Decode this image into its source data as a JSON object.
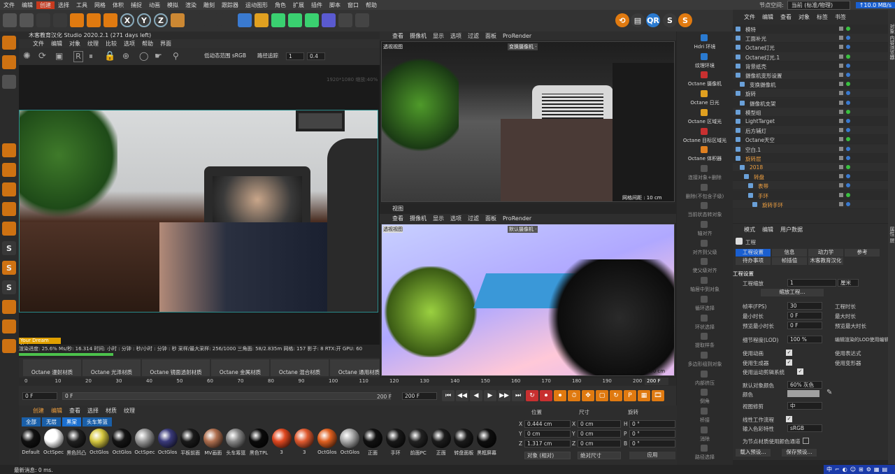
{
  "menubar": {
    "items": [
      "文件",
      "编辑",
      "创建",
      "选择",
      "工具",
      "网格",
      "体积",
      "捕捉",
      "动画",
      "模拟",
      "渲染",
      "雕刻",
      "跟踪器",
      "运动图形",
      "角色",
      "扩展",
      "插件",
      "脚本",
      "窗口",
      "帮助"
    ],
    "layout_label": "节点空间:",
    "layout_value": "当前 (标准/物理)",
    "net_speed": "↑10.0 MB/s"
  },
  "toolbar": {
    "icons": [
      "undo-icon",
      "redo-icon",
      "select-icon",
      "move-icon",
      "scale-icon",
      "rotate-icon",
      "recent-icon",
      "x-axis-icon",
      "y-axis-icon",
      "z-axis-icon",
      "coord-icon",
      "render-view-icon",
      "render-icon",
      "render-settings-icon",
      "cube-icon",
      "pen-icon",
      "subdiv-icon",
      "extrude-icon",
      "array-icon",
      "deformer-icon",
      "camera-icon",
      "light-icon"
    ],
    "xyz": [
      "X",
      "Y",
      "Z"
    ]
  },
  "left_tools": {
    "icons": [
      "model-mode-icon",
      "texture-mode-icon",
      "workplane-icon",
      "point-icon",
      "edge-icon",
      "polygon-icon",
      "uv-icon",
      "snap-icon",
      "s1-icon",
      "s2-icon",
      "s3-icon",
      "magnet-icon",
      "grid-icon",
      "paint-icon"
    ]
  },
  "preview": {
    "title": "木客教育汉化 Studio 2020.2.1 (271 days left)",
    "menu": [
      "文件",
      "编辑",
      "对象",
      "纹理",
      "比较",
      "选项",
      "帮助",
      "界面"
    ],
    "tonemap_label": "低动态范围 sRGB",
    "track": "路径追踪",
    "spin1": "1",
    "spin2": "0.4",
    "res_text": "1920*1080 缩放:40%",
    "caption": "Your Dream Noise",
    "status": "渲染进度: 25.6%  Ms/秒: 16.314  时间: 小时 : 分钟 : 秒/小时 : 分钟 : 秒  采样/最大采样: 256/1000  三角面: 58/2.835m  网格: 157  影子: 8  RTX:开  GPU:  60"
  },
  "octane_mat_tabs": [
    "Octane 漫射材质",
    "Octane 光泽材质",
    "Octane 镜面透射材质",
    "Octane 金属材质",
    "Octane 混合材质",
    "Octane 通用材质"
  ],
  "viewport_top": {
    "menu": [
      "查看",
      "摄像机",
      "显示",
      "选项",
      "过滤",
      "面板",
      "ProRender"
    ],
    "label": "透视视图",
    "cam": "变换摄像机 ·",
    "grid": "网格间距 : 10 cm"
  },
  "viewport_bottom": {
    "title": "视图",
    "menu": [
      "查看",
      "摄像机",
      "显示",
      "选项",
      "过滤",
      "面板",
      "ProRender"
    ],
    "label": "透视视图",
    "cam": "默认摄像机 ·",
    "grid": "网格间距 : 100 cm"
  },
  "octane_cmds": [
    "Hdri 环境",
    "纹理环境",
    "Octane 摄像机",
    "Octane 日光",
    "Octane 区域光",
    "Octane 目标区域光",
    "Octane 体积器",
    "连接对象+删除",
    "删除(不包含子级)",
    "当前状态转对象",
    "轴对齐",
    "对齐到父级",
    "使父级对齐",
    "轴居中到对象",
    "循环选择",
    "环状选择",
    "提取样条",
    "多边形组到对象",
    "内部挤压",
    "倒角",
    "桥接",
    "消除",
    "路径选择"
  ],
  "objects": {
    "header": [
      "文件",
      "编辑",
      "查看",
      "对象",
      "标签",
      "书签"
    ],
    "rows": [
      {
        "name": "模特",
        "indent": 0,
        "color": "#d0d0d0"
      },
      {
        "name": "工面补光",
        "indent": 0,
        "color": "#d0d0d0"
      },
      {
        "name": "Octane灯光",
        "indent": 0,
        "color": "#d0d0d0"
      },
      {
        "name": "Octane灯光.1",
        "indent": 0,
        "color": "#d0d0d0"
      },
      {
        "name": "背景纸壳",
        "indent": 0,
        "color": "#d0d0d0"
      },
      {
        "name": "摄像机变形设置",
        "indent": 0,
        "color": "#d0d0d0"
      },
      {
        "name": "变换摄像机",
        "indent": 1,
        "color": "#d0d0d0"
      },
      {
        "name": "旋转",
        "indent": 0,
        "color": "#d0d0d0"
      },
      {
        "name": "摄像机支架",
        "indent": 1,
        "color": "#d0d0d0"
      },
      {
        "name": "模型组",
        "indent": 0,
        "color": "#d0d0d0"
      },
      {
        "name": "LightTarget",
        "indent": 0,
        "color": "#d0d0d0"
      },
      {
        "name": "后方辅灯",
        "indent": 0,
        "color": "#d0d0d0"
      },
      {
        "name": "Octane天空",
        "indent": 0,
        "color": "#d0d0d0"
      },
      {
        "name": "空白.1",
        "indent": 0,
        "color": "#d0d0d0"
      },
      {
        "name": "旋转层",
        "indent": 0,
        "color": "#f0a040"
      },
      {
        "name": "2018",
        "indent": 1,
        "color": "#f0a040"
      },
      {
        "name": "转盘",
        "indent": 2,
        "color": "#f0a040"
      },
      {
        "name": "表带",
        "indent": 3,
        "color": "#f0a040"
      },
      {
        "name": "手环",
        "indent": 3,
        "color": "#f0a040"
      },
      {
        "name": "旋转手环",
        "indent": 4,
        "color": "#f0a040"
      }
    ]
  },
  "attributes": {
    "header": [
      "模式",
      "编辑",
      "用户数据"
    ],
    "object_name": "工程",
    "tabs1": [
      "工程设置",
      "信息",
      "动力学",
      "参考"
    ],
    "tabs2": [
      "待办事项",
      "帧插值",
      "木客教育汉化"
    ],
    "section": "工程设置",
    "scale_label": "工程缩放",
    "scale_value": "1",
    "scale_unit": "厘米",
    "scale_btn": "缩放工程...",
    "fps_label": "帧率(FPS)",
    "fps_value": "30",
    "min_label": "最小时长",
    "min_value": "0 F",
    "preview_min_label": "预览最小时长",
    "preview_min_value": "0 F",
    "proj_time": "工程时长",
    "max_time": "最大时长",
    "preview_max": "预览最大时长",
    "lod_label": "细节程度(LOD)",
    "lod_value": "100 %",
    "lod_right": "编辑渲染的LOD使用编辑",
    "anim_label": "使用动画",
    "expr_label": "使用表达式",
    "gen_label": "使用生成器",
    "deform_label": "使用变形器",
    "motion_label": "使用运动剪辑系统",
    "color_label": "默认对象颜色",
    "color_value": "60% 灰色",
    "colr_label": "颜色",
    "view_label": "视图修剪",
    "view_value": "中",
    "linear_label": "线性工作流程",
    "input_label": "输入色彩特性",
    "input_value": "sRGB",
    "node_label": "为节点材质使用颜色通道",
    "load_btn": "载入预设...",
    "save_btn": "保存预设..."
  },
  "timeline": {
    "ticks": [
      "0",
      "10",
      "20",
      "30",
      "40",
      "50",
      "60",
      "70",
      "80",
      "90",
      "100",
      "110",
      "120",
      "130",
      "140",
      "150",
      "160",
      "170",
      "180",
      "190",
      "200"
    ],
    "frame_end": "200 F",
    "f0": "0 F",
    "f1": "0 F",
    "f2": "200 F",
    "f3": "200 F",
    "f4": "200 F"
  },
  "materials": {
    "menu": [
      "创建",
      "编辑",
      "查看",
      "选择",
      "材质",
      "纹理"
    ],
    "filters": [
      "全部",
      "无层",
      "黑棠",
      "头车筹篮"
    ],
    "items": [
      {
        "name": "Default",
        "color": "#111"
      },
      {
        "name": "OctSpec",
        "color": "#fff"
      },
      {
        "name": "黑色凹凸",
        "color": "#202020"
      },
      {
        "name": "OctGlos",
        "color": "#d6c840"
      },
      {
        "name": "OctGlos",
        "color": "#151515"
      },
      {
        "name": "OctSpec",
        "color": "#999"
      },
      {
        "name": "OctGlos",
        "color": "#3a3a7a"
      },
      {
        "name": "平板前面",
        "color": "#1a1a1a"
      },
      {
        "name": "MV画面",
        "color": "#b07050"
      },
      {
        "name": "头车筹篮",
        "color": "#888"
      },
      {
        "name": "黑色TPL",
        "color": "#0a0a0a"
      },
      {
        "name": "3",
        "color": "#e04820"
      },
      {
        "name": "3",
        "color": "#e05a30"
      },
      {
        "name": "OctGlos",
        "color": "#e06020"
      },
      {
        "name": "OctGlos",
        "color": "#aaa"
      },
      {
        "name": "正面",
        "color": "#111"
      },
      {
        "name": "手环",
        "color": "#181818"
      },
      {
        "name": "前面PC",
        "color": "#222"
      },
      {
        "name": "正面",
        "color": "#1c1c1c"
      },
      {
        "name": "转盘面板",
        "color": "#1a1a1a"
      },
      {
        "name": "黑框屏幕",
        "color": "#0e0e0e"
      }
    ]
  },
  "coords": {
    "headers": [
      "位置",
      "尺寸",
      "旋转"
    ],
    "x": "0.444 cm",
    "y": "0 cm",
    "z": "1.317 cm",
    "sx": "0 cm",
    "sy": "0 cm",
    "sz": "0 cm",
    "h": "0 °",
    "p": "0 °",
    "b": "0 °",
    "mode1": "对象 (相对)",
    "mode2": "绝对尺寸",
    "apply": "应用"
  },
  "statusbar": {
    "text": "最新消息: 0 ms."
  },
  "tray": {
    "items": [
      "中",
      "⌐",
      "◐",
      "☺",
      "⊞",
      "⚙",
      "▦",
      "▤"
    ]
  },
  "right_edge": {
    "top": "对象 内容浏览器",
    "bottom": "属性 层"
  }
}
